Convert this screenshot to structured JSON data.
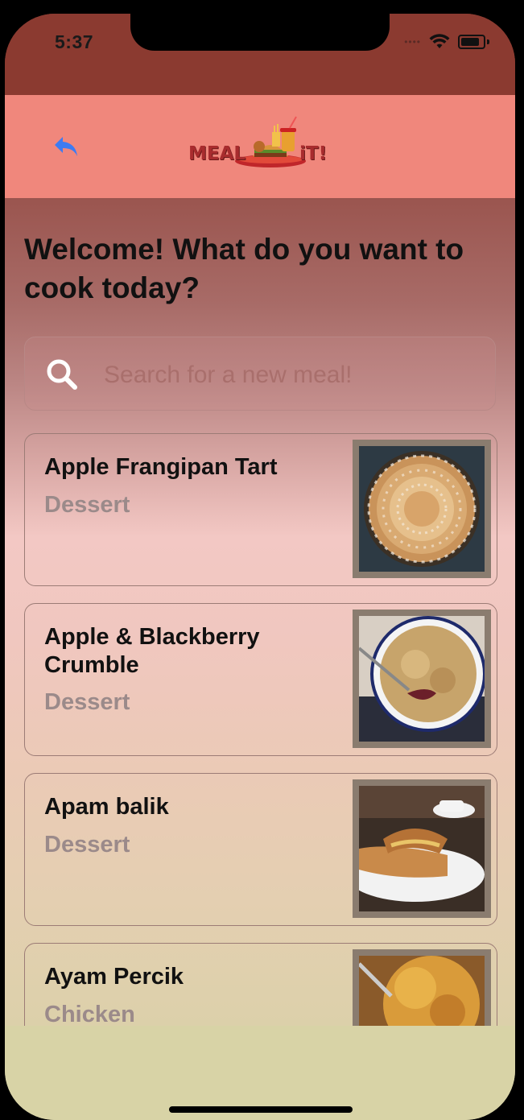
{
  "status_bar": {
    "time": "5:37"
  },
  "nav": {
    "logo_left": "MEAL",
    "logo_right": "iT!"
  },
  "headline": "Welcome! What do you want to cook today?",
  "search": {
    "placeholder": "Search for a new meal!"
  },
  "meals": [
    {
      "name": "Apple Frangipan Tart",
      "category": "Dessert",
      "image_icon": "tart-photo"
    },
    {
      "name": "Apple & Blackberry Crumble",
      "category": "Dessert",
      "image_icon": "crumble-photo"
    },
    {
      "name": "Apam balik",
      "category": "Dessert",
      "image_icon": "pancake-photo"
    },
    {
      "name": "Ayam Percik",
      "category": "Chicken",
      "image_icon": "chicken-photo"
    }
  ],
  "colors": {
    "navbar": "#f0877c",
    "status": "#8b3a30",
    "accent_blue": "#3d7bf2"
  }
}
